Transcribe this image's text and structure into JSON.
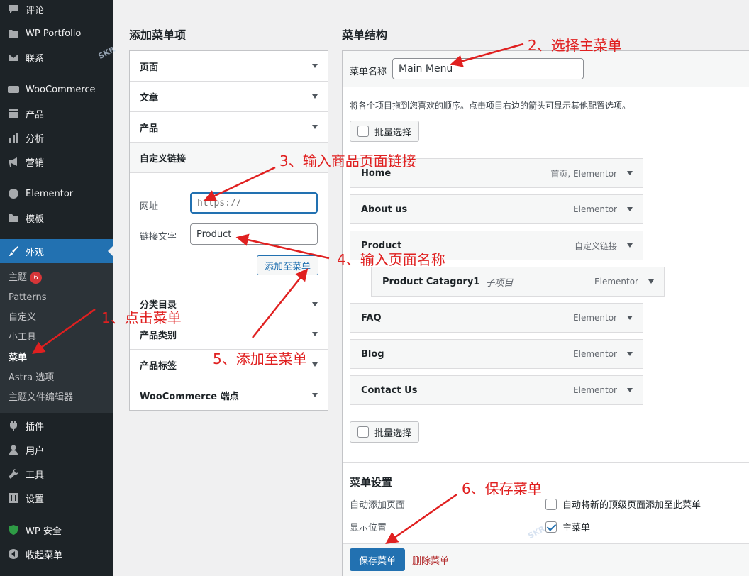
{
  "sidebar": {
    "items": [
      {
        "label": "评论",
        "icon": "comment-icon"
      },
      {
        "label": "WP Portfolio",
        "icon": "folder-icon"
      },
      {
        "label": "联系",
        "icon": "mail-icon"
      },
      {
        "label": "WooCommerce",
        "icon": "woo-icon"
      },
      {
        "label": "产品",
        "icon": "archive-icon"
      },
      {
        "label": "分析",
        "icon": "chart-icon"
      },
      {
        "label": "营销",
        "icon": "megaphone-icon"
      },
      {
        "label": "Elementor",
        "icon": "elementor-icon"
      },
      {
        "label": "模板",
        "icon": "folder-icon"
      },
      {
        "label": "外观",
        "icon": "brush-icon"
      },
      {
        "label": "插件",
        "icon": "plugin-icon"
      },
      {
        "label": "用户",
        "icon": "user-icon"
      },
      {
        "label": "工具",
        "icon": "wrench-icon"
      },
      {
        "label": "设置",
        "icon": "settings-icon"
      },
      {
        "label": "WP 安全",
        "icon": "shield-icon"
      },
      {
        "label": "收起菜单",
        "icon": "collapse-icon"
      }
    ],
    "submenu": [
      {
        "label": "主题",
        "badge": "6"
      },
      {
        "label": "Patterns"
      },
      {
        "label": "自定义"
      },
      {
        "label": "小工具"
      },
      {
        "label": "菜单"
      },
      {
        "label": "Astra 选项"
      },
      {
        "label": "主题文件编辑器"
      }
    ]
  },
  "add_items": {
    "heading": "添加菜单项",
    "sections": [
      "页面",
      "文章",
      "产品",
      "自定义链接",
      "分类目录",
      "产品类别",
      "产品标签",
      "WooCommerce 端点"
    ],
    "url_label": "网址",
    "url_placeholder": "https://",
    "link_text_label": "链接文字",
    "link_text_value": "Product",
    "add_button": "添加至菜单"
  },
  "structure": {
    "heading": "菜单结构",
    "name_label": "菜单名称",
    "name_value": "Main Menu",
    "instructions": "将各个项目拖到您喜欢的顺序。点击项目右边的箭头可显示其他配置选项。",
    "bulk_select": "批量选择",
    "items": [
      {
        "label": "Home",
        "meta": "首页, Elementor"
      },
      {
        "label": "About us",
        "meta": "Elementor"
      },
      {
        "label": "Product",
        "meta": "自定义链接"
      },
      {
        "label": "Product Catagory1",
        "sub": "子项目",
        "meta": "Elementor"
      },
      {
        "label": "FAQ",
        "meta": "Elementor"
      },
      {
        "label": "Blog",
        "meta": "Elementor"
      },
      {
        "label": "Contact Us",
        "meta": "Elementor"
      }
    ],
    "settings_heading": "菜单设置",
    "auto_add_label": "自动添加页面",
    "auto_add_option": "自动将新的顶级页面添加至此菜单",
    "display_label": "显示位置",
    "display_option": "主菜单",
    "save_button": "保存菜单",
    "delete_link": "删除菜单"
  },
  "annotations": {
    "a1": "1、点击菜单",
    "a2": "2、选择主菜单",
    "a3": "3、输入商品页面链接",
    "a4": "4、输入页面名称",
    "a5": "5、添加至菜单",
    "a6": "6、保存菜单"
  },
  "colors": {
    "accent": "#2271b1",
    "annotation": "#e02020",
    "sidebar": "#1d2327"
  }
}
